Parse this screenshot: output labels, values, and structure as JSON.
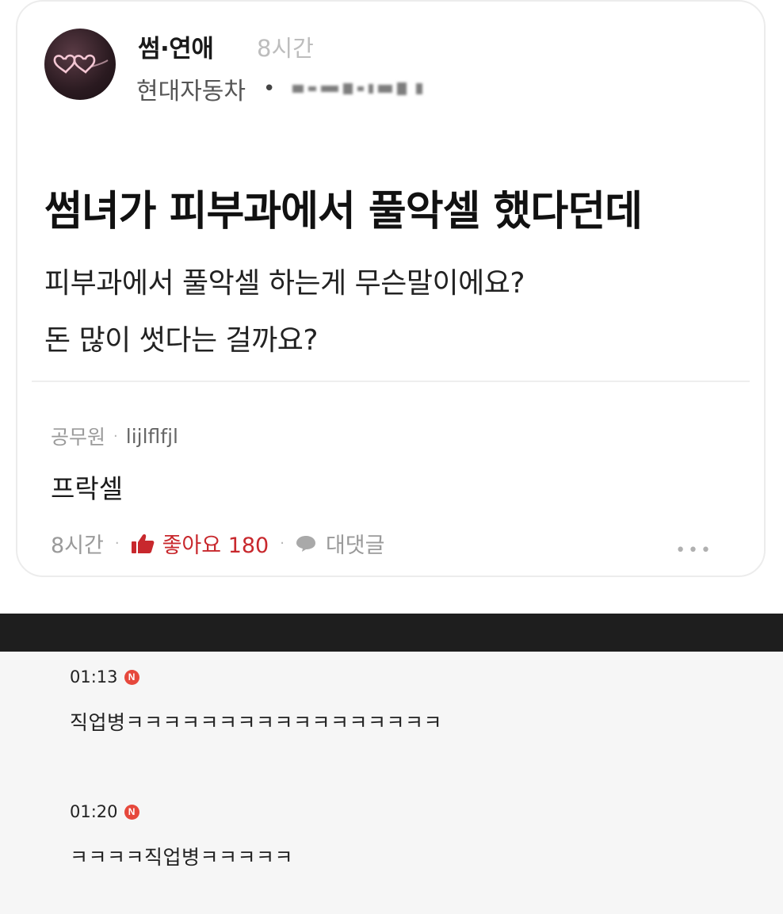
{
  "post": {
    "board_name": "썸·연애",
    "time": "8시간",
    "company": "현대자동차",
    "separator": "•",
    "title": "썸녀가 피부과에서 풀악셀 했다던데",
    "body_lines": [
      "피부과에서 풀악셀 하는게 무슨말이에요?",
      "돈 많이 썻다는 걸까요?"
    ]
  },
  "top_comment": {
    "company": "공무원",
    "separator": "·",
    "nickname": "lijlflfjl",
    "text": "프락셀",
    "time": "8시간",
    "like_label": "좋아요 180",
    "reply_label": "대댓글",
    "more_label": "•••"
  },
  "comments": [
    {
      "time": "01:13",
      "badge": "N",
      "text": "직업병ㅋㅋㅋㅋㅋㅋㅋㅋㅋㅋㅋㅋㅋㅋㅋㅋㅋ"
    },
    {
      "time": "01:20",
      "badge": "N",
      "text": "ㅋㅋㅋㅋ직업병ㅋㅋㅋㅋㅋ"
    }
  ],
  "colors": {
    "like_red": "#c8282d",
    "badge_red": "#e6483c",
    "band_dark": "#1e1e1e",
    "comment_bg": "#f6f6f6"
  },
  "icons": [
    "avatar-hearts-icon",
    "thumbs-up-icon",
    "speech-bubble-icon",
    "more-dots-icon",
    "new-badge-icon"
  ]
}
